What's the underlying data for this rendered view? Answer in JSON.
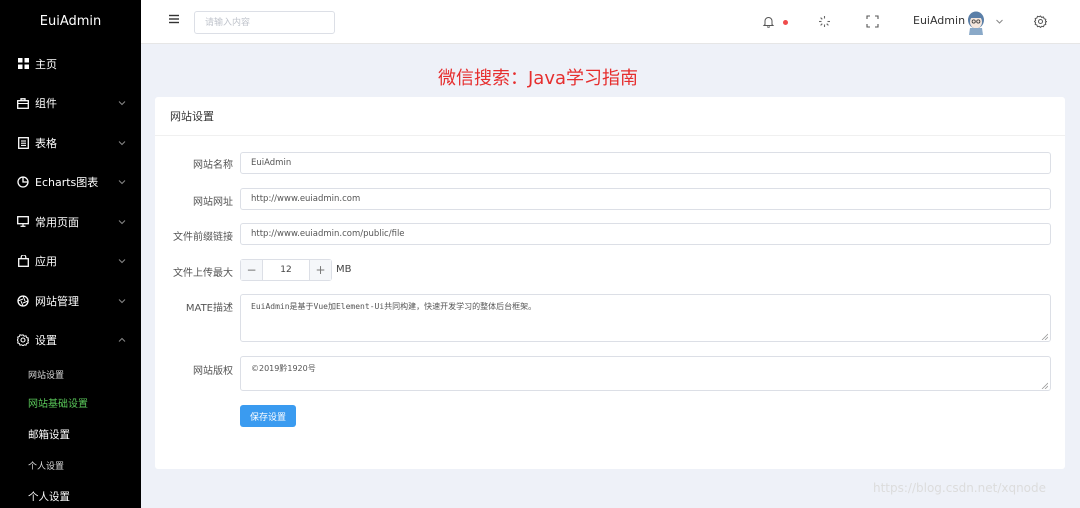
{
  "app": {
    "title": "EuiAdmin"
  },
  "sidebar": {
    "items": [
      {
        "label": "主页",
        "icon": "grid-icon"
      },
      {
        "label": "组件",
        "icon": "briefcase-icon"
      },
      {
        "label": "表格",
        "icon": "table-icon"
      },
      {
        "label": "Echarts图表",
        "icon": "pie-chart-icon"
      },
      {
        "label": "常用页面",
        "icon": "monitor-icon"
      },
      {
        "label": "应用",
        "icon": "bag-icon"
      },
      {
        "label": "网站管理",
        "icon": "aperture-icon"
      },
      {
        "label": "设置",
        "icon": "gear-icon"
      }
    ],
    "sub_items": [
      {
        "label": "网站设置"
      },
      {
        "label": "网站基础设置"
      },
      {
        "label": "邮箱设置"
      },
      {
        "label": "个人设置"
      },
      {
        "label": "个人设置"
      }
    ]
  },
  "header": {
    "search_placeholder": "请输入内容",
    "username": "EuiAdmin"
  },
  "banner": {
    "text": "微信搜索：Java学习指南"
  },
  "card": {
    "title": "网站设置",
    "fields": {
      "site_name": {
        "label": "网站名称",
        "value": "EuiAdmin"
      },
      "site_url": {
        "label": "网站网址",
        "value": "http://www.euiadmin.com"
      },
      "file_prefix": {
        "label": "文件前缀链接",
        "value": "http://www.euiadmin.com/public/file"
      },
      "upload_max": {
        "label": "文件上传最大",
        "value": "12",
        "unit": "MB"
      },
      "mate_desc": {
        "label": "MATE描述",
        "value": "EuiAdmin是基于Vue加Element-Ui共同构建，快速开发学习的整体后台框架。"
      },
      "copyright": {
        "label": "网站版权",
        "value": "©2019黔1920号"
      }
    },
    "save_label": "保存设置"
  },
  "watermark": {
    "text": "https://blog.csdn.net/xqnode"
  },
  "colors": {
    "sidebar_bg": "#000000",
    "active_submenu": "#5ac85a",
    "primary": "#3a9bf0",
    "banner_red": "#e62e2e",
    "notify_dot": "#ef4b4b"
  }
}
